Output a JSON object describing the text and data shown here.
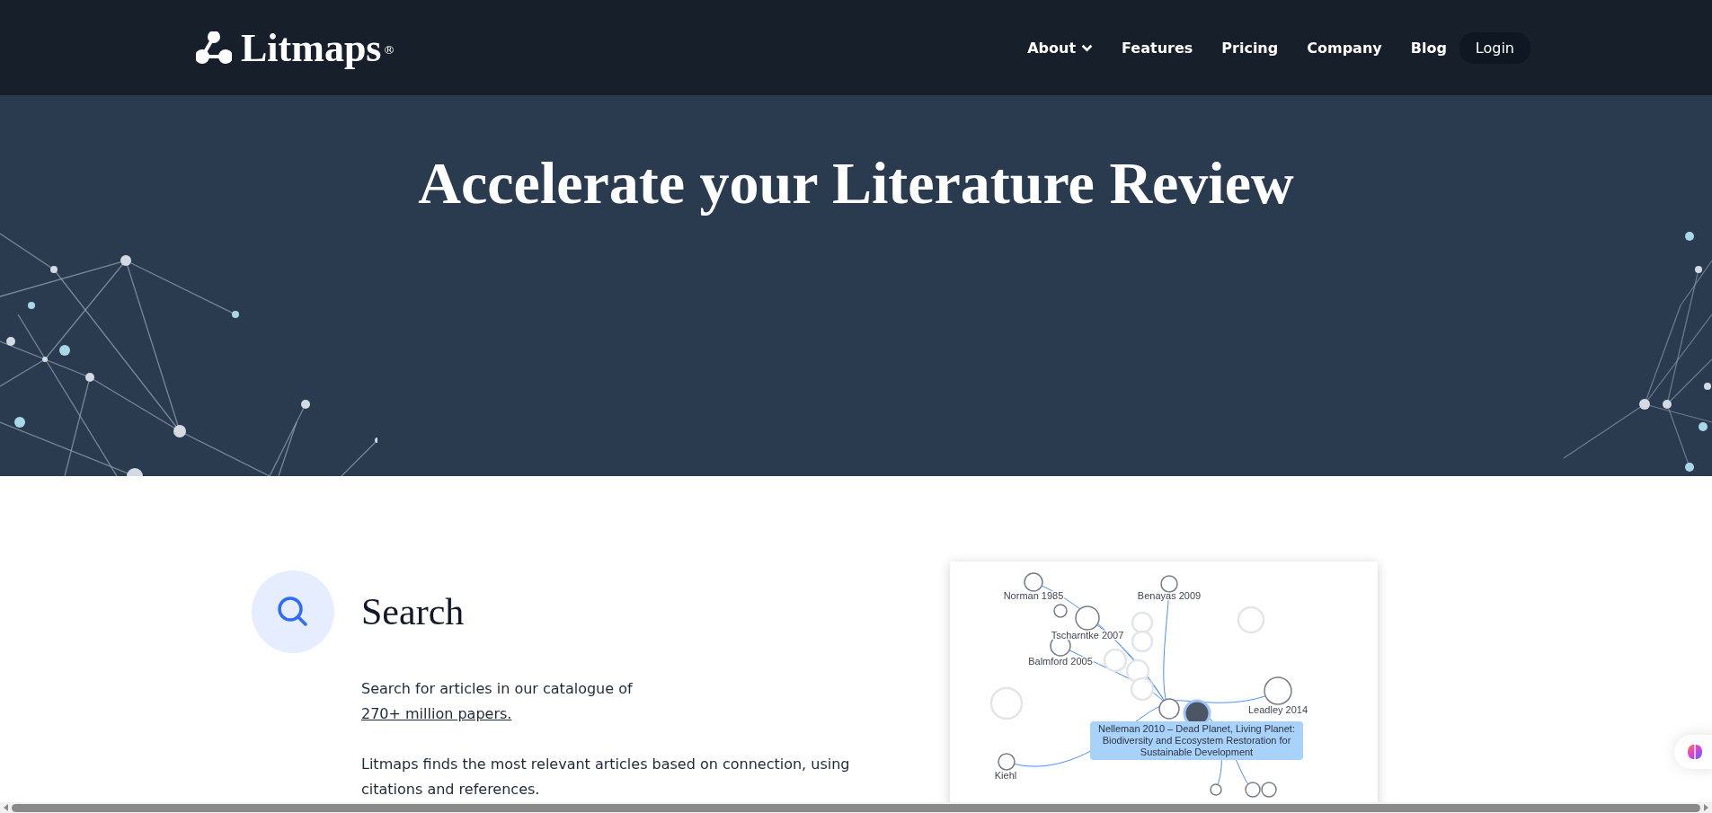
{
  "header": {
    "logo": {
      "text": "Litmaps",
      "mark": "®"
    },
    "nav": [
      {
        "label": "About",
        "dropdown": true
      },
      {
        "label": "Features",
        "dropdown": false
      },
      {
        "label": "Pricing",
        "dropdown": false
      },
      {
        "label": "Company",
        "dropdown": false
      },
      {
        "label": "Blog",
        "dropdown": false
      }
    ],
    "login": "Login"
  },
  "hero": {
    "title": "Accelerate your Literature Review"
  },
  "feature": {
    "title": "Search",
    "intro": "Search for articles in our catalogue of",
    "link": "270+ million papers.",
    "paragraph": "Litmaps finds the most relevant articles based on connection, using citations and references."
  },
  "map": {
    "nodes": [
      {
        "label": "Norman 1985"
      },
      {
        "label": "Benayas 2009"
      },
      {
        "label": "Tscharntke 2007"
      },
      {
        "label": "Balmford 2005"
      },
      {
        "label": "Leadley 2014"
      },
      {
        "label": "Kiehl"
      }
    ],
    "tooltip": "Nelleman 2010 – Dead Planet, Living Planet: Biodiversity and Ecosystem Restoration for Sustainable Development"
  }
}
